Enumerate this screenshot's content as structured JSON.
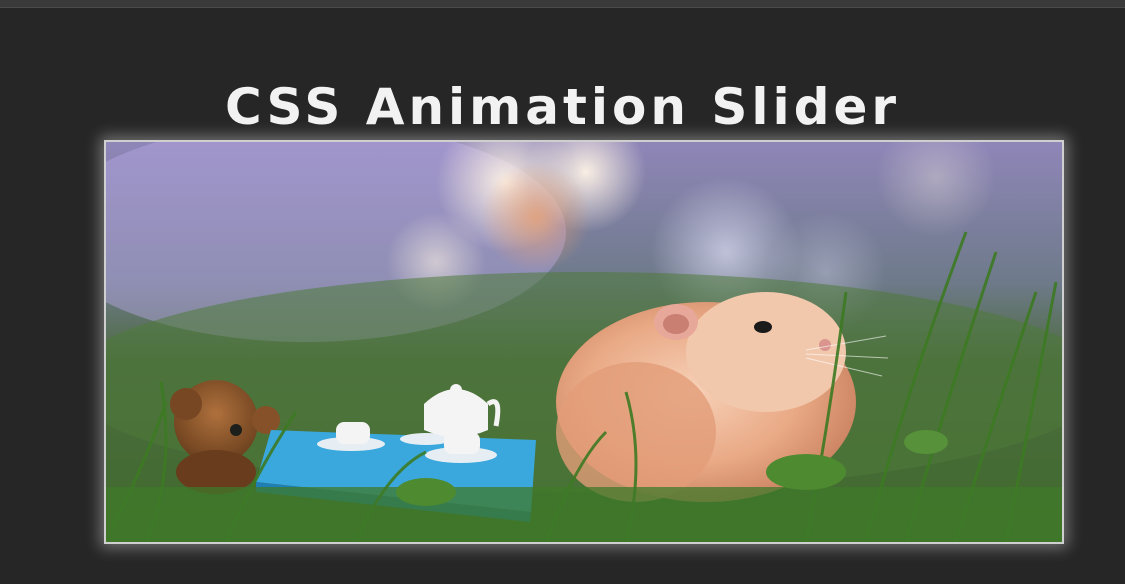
{
  "page": {
    "title": "CSS Animation Slider"
  },
  "slider": {
    "slide_description_icon": "hamster-photo",
    "colors": {
      "background": "#262626",
      "title": "#f2f2f2",
      "frame": "#cfcfcf"
    }
  }
}
